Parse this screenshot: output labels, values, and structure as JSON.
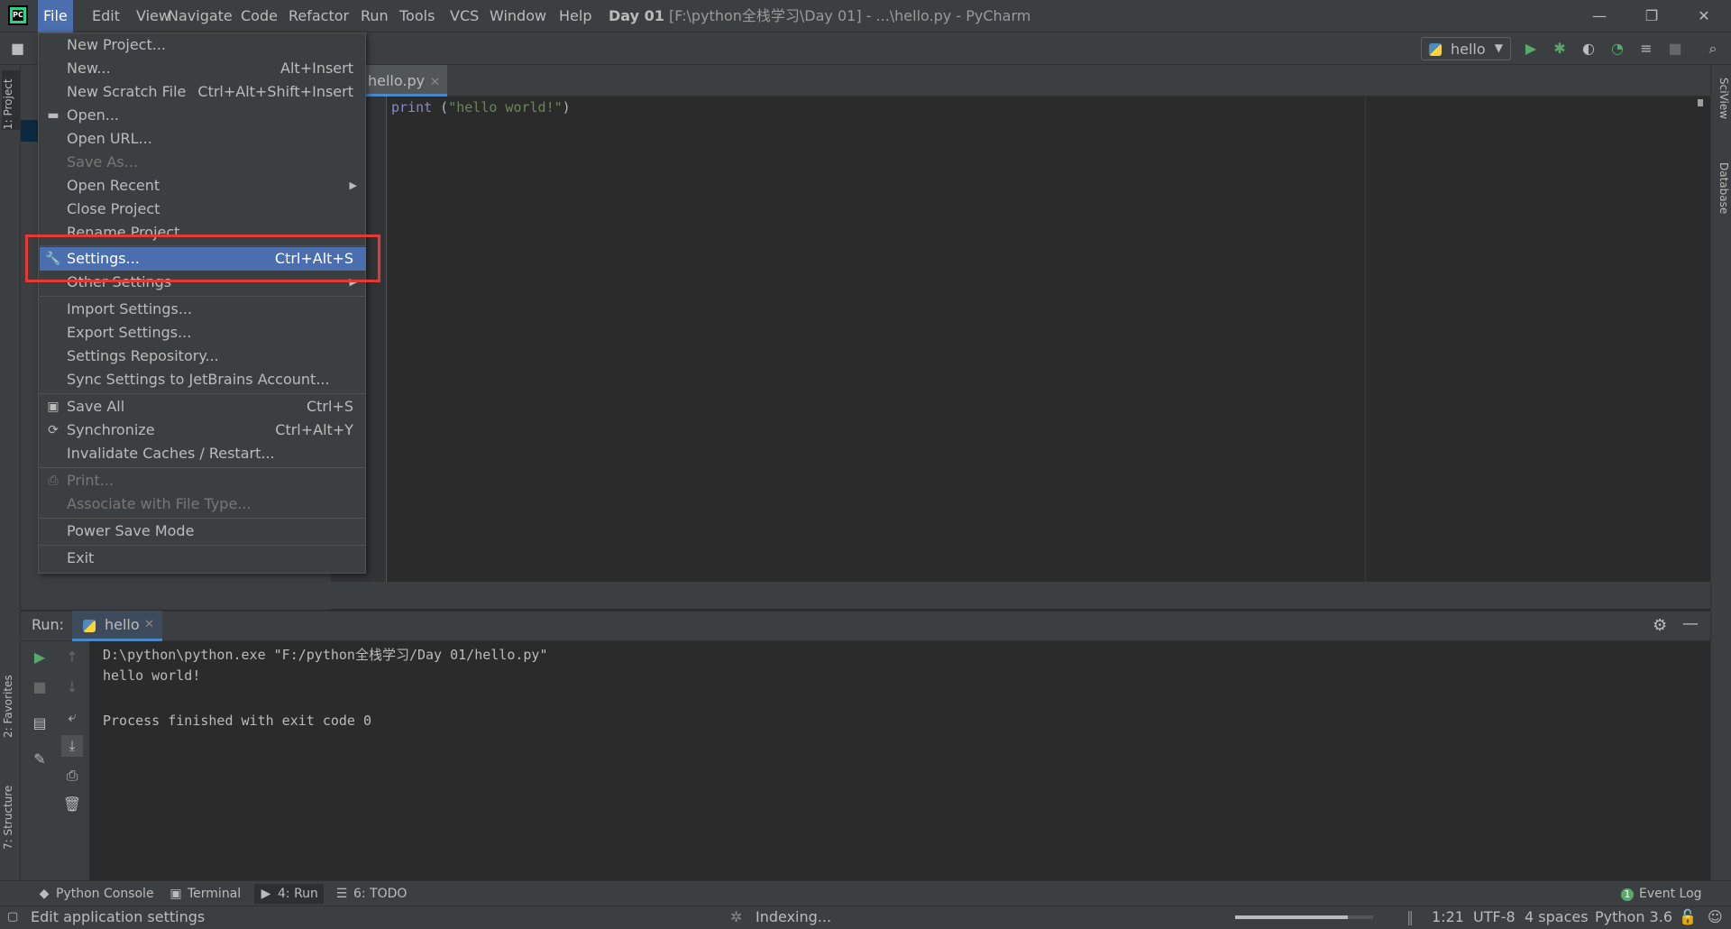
{
  "window": {
    "title_bold": "Day 01",
    "title_rest": " [F:\\python全栈学习\\Day 01] - ...\\hello.py - PyCharm",
    "controls": [
      "—",
      "❐",
      "✕"
    ]
  },
  "menubar": [
    "File",
    "Edit",
    "View",
    "Navigate",
    "Code",
    "Refactor",
    "Run",
    "Tools",
    "VCS",
    "Window",
    "Help"
  ],
  "navbar": {
    "run_config": "hello"
  },
  "sidebar": {
    "left_tabs": [
      "1: Project",
      "2: Favorites",
      "7: Structure"
    ],
    "right_tabs": [
      "SciView",
      "Database"
    ]
  },
  "editor": {
    "tab_label": "hello.py",
    "code": {
      "fn": "print",
      "open": " (",
      "str": "\"hello world!\"",
      "close": ")"
    }
  },
  "file_menu": {
    "items": [
      {
        "label": "New Project...",
        "shortcut": "",
        "icon": "",
        "disabled": false
      },
      {
        "label": "New...",
        "shortcut": "Alt+Insert",
        "icon": "",
        "disabled": false
      },
      {
        "label": "New Scratch File",
        "shortcut": "Ctrl+Alt+Shift+Insert",
        "icon": "",
        "disabled": false
      },
      {
        "label": "Open...",
        "shortcut": "",
        "icon": "folder-icon",
        "disabled": false
      },
      {
        "label": "Open URL...",
        "shortcut": "",
        "icon": "",
        "disabled": false
      },
      {
        "label": "Save As...",
        "shortcut": "",
        "icon": "",
        "disabled": true
      },
      {
        "label": "Open Recent",
        "shortcut": "",
        "icon": "",
        "disabled": false,
        "submenu": true
      },
      {
        "label": "Close Project",
        "shortcut": "",
        "icon": "",
        "disabled": false
      },
      {
        "label": "Rename Project...",
        "shortcut": "",
        "icon": "",
        "disabled": false
      },
      {
        "label": "Settings...",
        "shortcut": "Ctrl+Alt+S",
        "icon": "wrench-icon",
        "disabled": false,
        "selected": true
      },
      {
        "label": "Other Settings",
        "shortcut": "",
        "icon": "",
        "disabled": false,
        "submenu": true
      },
      {
        "label": "Import Settings...",
        "shortcut": "",
        "icon": "",
        "disabled": false
      },
      {
        "label": "Export Settings...",
        "shortcut": "",
        "icon": "",
        "disabled": false
      },
      {
        "label": "Settings Repository...",
        "shortcut": "",
        "icon": "",
        "disabled": false
      },
      {
        "label": "Sync Settings to JetBrains Account...",
        "shortcut": "",
        "icon": "",
        "disabled": false
      },
      {
        "label": "Save All",
        "shortcut": "Ctrl+S",
        "icon": "save-icon",
        "disabled": false
      },
      {
        "label": "Synchronize",
        "shortcut": "Ctrl+Alt+Y",
        "icon": "sync-icon",
        "disabled": false
      },
      {
        "label": "Invalidate Caches / Restart...",
        "shortcut": "",
        "icon": "",
        "disabled": false
      },
      {
        "label": "Print...",
        "shortcut": "",
        "icon": "print-icon",
        "disabled": true
      },
      {
        "label": "Associate with File Type...",
        "shortcut": "",
        "icon": "",
        "disabled": true
      },
      {
        "label": "Power Save Mode",
        "shortcut": "",
        "icon": "",
        "disabled": false
      },
      {
        "label": "Exit",
        "shortcut": "",
        "icon": "",
        "disabled": false
      }
    ]
  },
  "run_panel": {
    "label": "Run:",
    "tab": "hello",
    "console": [
      "D:\\python\\python.exe \"F:/python全栈学习/Day 01/hello.py\"",
      "hello world!",
      "",
      "Process finished with exit code 0"
    ]
  },
  "bottom_tabs": [
    {
      "label": "Python Console",
      "icon": "python-icon"
    },
    {
      "label": "Terminal",
      "icon": "terminal-icon"
    },
    {
      "label": "4: Run",
      "icon": "run-icon"
    },
    {
      "label": "6: TODO",
      "icon": "todo-icon"
    }
  ],
  "event_log": {
    "count": "1",
    "label": "Event Log"
  },
  "status": {
    "message": "Edit application settings",
    "indexing": "Indexing...",
    "indexing_progress": 0.82,
    "position": "1:21",
    "encoding": "UTF-8",
    "indent": "4 spaces",
    "interpreter": "Python 3.6"
  },
  "colors": {
    "accent": "#4b6eaf",
    "highlight_box": "#e53935",
    "run_green": "#59a869"
  }
}
